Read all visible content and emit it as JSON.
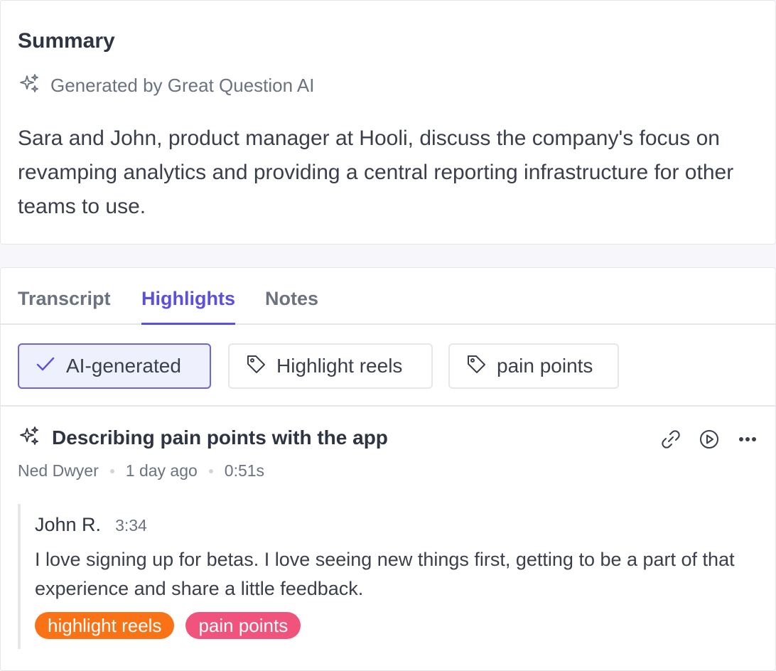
{
  "summary": {
    "title": "Summary",
    "generated_by": "Generated by Great Question AI",
    "text": "Sara and John, product manager at Hooli, discuss the company's focus on revamping analytics and providing a central reporting infrastructure for other teams to use."
  },
  "tabs": [
    {
      "label": "Transcript",
      "active": false
    },
    {
      "label": "Highlights",
      "active": true
    },
    {
      "label": "Notes",
      "active": false
    }
  ],
  "filters": [
    {
      "label": "AI-generated",
      "icon": "check-icon",
      "selected": true
    },
    {
      "label": "Highlight reels",
      "icon": "tag-icon",
      "selected": false
    },
    {
      "label": "pain points",
      "icon": "tag-icon",
      "selected": false
    }
  ],
  "highlight": {
    "title": "Describing pain points with the app",
    "author": "Ned Dwyer",
    "age": "1 day ago",
    "duration": "0:51s",
    "quote": {
      "speaker": "John R.",
      "timestamp": "3:34",
      "text": "I love signing up for betas. I love seeing new things first, getting to be a part of that experience and share a little feedback."
    },
    "tags": [
      {
        "label": "highlight reels",
        "color": "#f97316"
      },
      {
        "label": "pain points",
        "color": "#f0547c"
      }
    ]
  },
  "colors": {
    "accent": "#5b4fe0"
  }
}
